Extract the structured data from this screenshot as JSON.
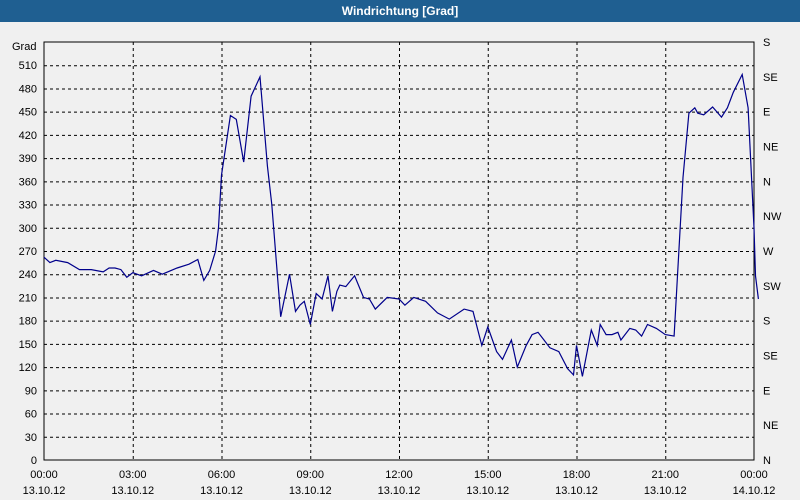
{
  "title": "Windrichtung [Grad]",
  "chart_data": {
    "type": "line",
    "title": "Windrichtung [Grad]",
    "ylabel": "Grad",
    "xlabel": "",
    "ylim": [
      0,
      540
    ],
    "xlim": [
      0,
      24
    ],
    "grid": true,
    "line_color": "#00008b",
    "y_ticks": [
      0,
      30,
      60,
      90,
      120,
      150,
      180,
      210,
      240,
      270,
      300,
      330,
      360,
      390,
      420,
      450,
      480,
      510
    ],
    "y_tick_labels": [
      "0",
      "30",
      "60",
      "90",
      "120",
      "150",
      "180",
      "210",
      "240",
      "270",
      "300",
      "330",
      "360",
      "390",
      "420",
      "450",
      "480",
      "510"
    ],
    "right_ticks": [
      0,
      45,
      90,
      135,
      180,
      225,
      270,
      315,
      360,
      405,
      450,
      495,
      540
    ],
    "right_tick_labels": [
      "N",
      "NE",
      "E",
      "SE",
      "S",
      "SW",
      "W",
      "NW",
      "N",
      "NE",
      "E",
      "SE",
      "S"
    ],
    "x_ticks": [
      0,
      3,
      6,
      9,
      12,
      15,
      18,
      21,
      24
    ],
    "x_tick_times": [
      "00:00",
      "03:00",
      "06:00",
      "09:00",
      "12:00",
      "15:00",
      "18:00",
      "21:00",
      "00:00"
    ],
    "x_tick_dates": [
      "13.10.12",
      "13.10.12",
      "13.10.12",
      "13.10.12",
      "13.10.12",
      "13.10.12",
      "13.10.12",
      "13.10.12",
      "14.10.12"
    ],
    "series": [
      {
        "x": [
          0,
          0.2,
          0.4,
          0.8,
          1.2,
          1.6,
          2.0,
          2.2,
          2.4,
          2.6,
          2.8,
          3.0,
          3.3,
          3.7,
          4.0,
          4.5,
          4.9,
          5.2,
          5.4,
          5.6,
          5.8,
          5.9,
          6.0,
          6.3,
          6.5,
          6.75,
          7.0,
          7.3,
          7.55,
          7.7,
          8.0,
          8.3,
          8.5,
          8.65,
          8.8,
          9.0,
          9.2,
          9.4,
          9.6,
          9.75,
          9.9,
          10.0,
          10.2,
          10.5,
          10.8,
          11.0,
          11.2,
          11.6,
          12.0,
          12.2,
          12.5,
          12.9,
          13.3,
          13.7,
          14.2,
          14.5,
          14.8,
          15.0,
          15.3,
          15.5,
          15.8,
          16.0,
          16.3,
          16.5,
          16.7,
          16.9,
          17.1,
          17.4,
          17.7,
          17.9,
          18.0,
          18.2,
          18.5,
          18.7,
          18.8,
          19.0,
          19.2,
          19.4,
          19.5,
          19.8,
          20.0,
          20.2,
          20.4,
          20.7,
          21.0,
          21.3,
          21.6,
          21.8,
          22.0,
          22.1,
          22.3,
          22.6,
          22.9,
          23.1,
          23.3,
          23.6,
          23.8,
          24.0,
          24.05,
          24.15
        ],
        "y": [
          262,
          255,
          258,
          255,
          246,
          246,
          243,
          248,
          248,
          246,
          236,
          242,
          238,
          245,
          240,
          248,
          253,
          259,
          232,
          245,
          270,
          300,
          368,
          445,
          440,
          385,
          470,
          495,
          380,
          330,
          185,
          240,
          192,
          200,
          205,
          175,
          215,
          208,
          238,
          192,
          218,
          226,
          224,
          238,
          210,
          208,
          195,
          210,
          208,
          200,
          210,
          205,
          190,
          182,
          195,
          192,
          148,
          172,
          140,
          130,
          155,
          120,
          148,
          162,
          165,
          155,
          145,
          140,
          118,
          110,
          148,
          108,
          168,
          148,
          175,
          162,
          162,
          165,
          155,
          170,
          168,
          160,
          175,
          170,
          162,
          160,
          365,
          448,
          455,
          448,
          446,
          456,
          443,
          455,
          475,
          498,
          455,
          300,
          238,
          208
        ]
      }
    ]
  }
}
